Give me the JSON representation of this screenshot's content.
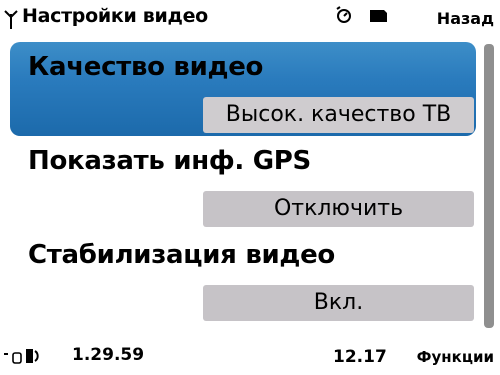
{
  "header": {
    "title": "Настройки видео",
    "back_label": "Назад",
    "icons": [
      "signal-icon",
      "alarm-icon",
      "memory-card-icon"
    ]
  },
  "settings": [
    {
      "label": "Качество видео",
      "value": "Высок. качество ТВ",
      "selected": true
    },
    {
      "label": "Показать инф. GPS",
      "value": "Отключить",
      "selected": false
    },
    {
      "label": "Стабилизация видео",
      "value": "Вкл.",
      "selected": false
    }
  ],
  "footer": {
    "recording_time": "1.29.59",
    "clock": "12.17",
    "functions_label": "Функции",
    "icons": [
      "storage-icon",
      "battery-icon"
    ]
  },
  "colors": {
    "selection": "#2a7bbd",
    "value_box": "#c6c3c7",
    "scrollbar": "#8f8f8f"
  }
}
